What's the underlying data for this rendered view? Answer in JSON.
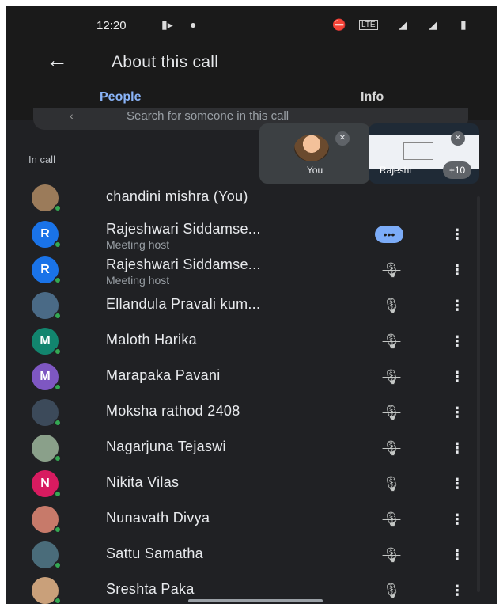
{
  "status_bar": {
    "time": "12:20",
    "icons": [
      "video-camera-icon",
      "microphone-icon",
      "dnd-icon",
      "volte-icon",
      "signal-icon",
      "signal-icon",
      "battery-icon"
    ],
    "volte_label": "LTE"
  },
  "header": {
    "title": "About this call",
    "back_icon": "arrow-left-icon"
  },
  "tabs": [
    {
      "label": "People",
      "selected": true
    },
    {
      "label": "Info",
      "selected": false
    }
  ],
  "search": {
    "placeholder": "Search for someone in this call"
  },
  "section_label": "In call",
  "tiles": {
    "you_label": "You",
    "presenter_label": "Rajeshi",
    "more_count": "+10"
  },
  "participants": [
    {
      "name": "chandini mishra (You)",
      "subtitle": "",
      "avatar_letter": "",
      "avatar_color": "#9b7b5a",
      "status": "none"
    },
    {
      "name": "Rajeshwari Siddamse...",
      "subtitle": "Meeting host",
      "avatar_letter": "R",
      "avatar_color": "#1a73e8",
      "status": "speaking"
    },
    {
      "name": "Rajeshwari Siddamse...",
      "subtitle": "Meeting host",
      "avatar_letter": "R",
      "avatar_color": "#1a73e8",
      "status": "muted"
    },
    {
      "name": "Ellandula Pravali kum...",
      "subtitle": "",
      "avatar_letter": "",
      "avatar_color": "#4a6a86",
      "status": "muted"
    },
    {
      "name": "Maloth Harika",
      "subtitle": "",
      "avatar_letter": "M",
      "avatar_color": "#12856e",
      "status": "muted"
    },
    {
      "name": "Marapaka Pavani",
      "subtitle": "",
      "avatar_letter": "M",
      "avatar_color": "#7e57c2",
      "status": "muted"
    },
    {
      "name": "Moksha rathod 2408",
      "subtitle": "",
      "avatar_letter": "",
      "avatar_color": "#3c4a5a",
      "status": "muted"
    },
    {
      "name": "Nagarjuna Tejaswi",
      "subtitle": "",
      "avatar_letter": "",
      "avatar_color": "#8aa08a",
      "status": "muted"
    },
    {
      "name": "Nikita Vilas",
      "subtitle": "",
      "avatar_letter": "N",
      "avatar_color": "#d81b60",
      "status": "muted"
    },
    {
      "name": "Nunavath Divya",
      "subtitle": "",
      "avatar_letter": "",
      "avatar_color": "#c77a6a",
      "status": "muted"
    },
    {
      "name": "Sattu Samatha",
      "subtitle": "",
      "avatar_letter": "",
      "avatar_color": "#4a6c7a",
      "status": "muted"
    },
    {
      "name": "Sreshta Paka",
      "subtitle": "",
      "avatar_letter": "",
      "avatar_color": "#c9a07a",
      "status": "muted"
    }
  ],
  "icons": {
    "speaking": "•••",
    "muted": "🎙︎",
    "menu": "⋮",
    "back": "←",
    "search": "‹"
  },
  "accent_color": "#8ab4f8"
}
